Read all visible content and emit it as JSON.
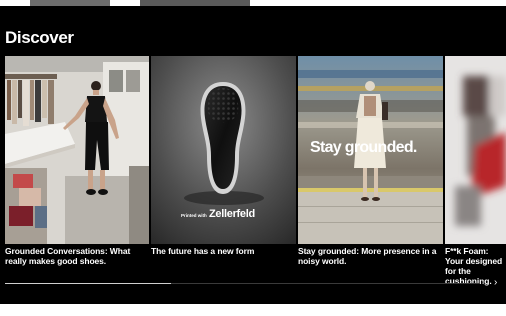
{
  "section": {
    "title": "Discover"
  },
  "cards": [
    {
      "caption": "Grounded Conversations: What really makes good shoes."
    },
    {
      "caption": "The future has a new form",
      "overlay_small": "Printed with",
      "overlay_brand": "Zellerfeld"
    },
    {
      "caption": "Stay grounded: More presence in a noisy world.",
      "overlay_text": "Stay grounded."
    },
    {
      "caption": "F**k Foam: Your designed for the cushioning."
    }
  ],
  "carousel": {
    "progress": 0.35,
    "prev_icon": "chevron-left-icon",
    "next_icon": "chevron-right-icon",
    "prev_glyph": "‹",
    "next_glyph": "›"
  },
  "colors": {
    "background": "#000000",
    "text": "#ffffff",
    "progress_fill": "#cfcfcf",
    "progress_track": "#3a3a3a"
  }
}
